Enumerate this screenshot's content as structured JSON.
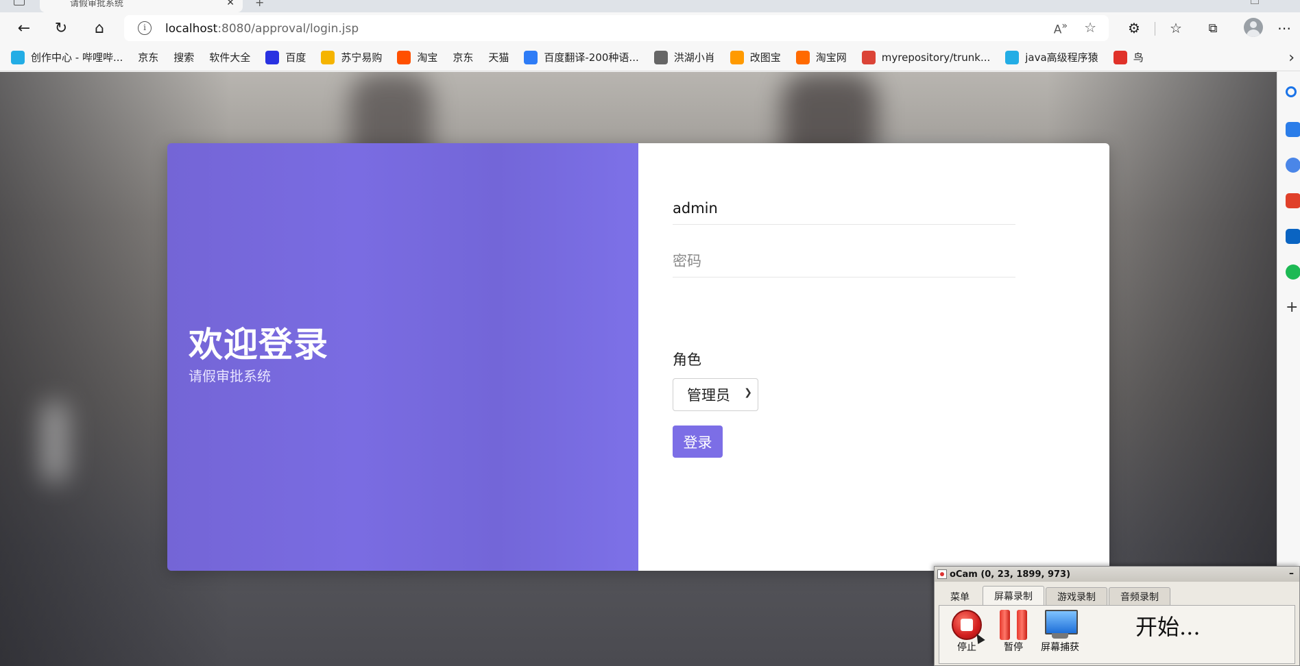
{
  "browser": {
    "tab_title": "请假审批系统",
    "url_host": "localhost",
    "url_rest": ":8080/approval/login.jsp",
    "bookmarks": [
      {
        "label": "创作中心 - 哔哩哔...",
        "icon": "bilibili-icon",
        "color": "#23ade5"
      },
      {
        "label": "京东",
        "icon": "page-icon"
      },
      {
        "label": "搜索",
        "icon": "page-icon"
      },
      {
        "label": "软件大全",
        "icon": "page-icon"
      },
      {
        "label": "百度",
        "icon": "baidu-icon",
        "color": "#2932e1"
      },
      {
        "label": "苏宁易购",
        "icon": "suning-icon",
        "color": "#f5b400"
      },
      {
        "label": "淘宝",
        "icon": "taobao-icon",
        "color": "#ff5000"
      },
      {
        "label": "京东",
        "icon": "page-icon"
      },
      {
        "label": "天猫",
        "icon": "page-icon"
      },
      {
        "label": "百度翻译-200种语...",
        "icon": "baidu-translate-icon",
        "color": "#2e7cf6"
      },
      {
        "label": "洪湖小肖",
        "icon": "bird-icon",
        "color": "#666666"
      },
      {
        "label": "改图宝",
        "icon": "gaitubao-icon",
        "color": "#ff9a00"
      },
      {
        "label": "淘宝网",
        "icon": "taobao-icon",
        "color": "#ff6a00"
      },
      {
        "label": "myrepository/trunk...",
        "icon": "chrome-icon",
        "color": "#db4437"
      },
      {
        "label": "java高级程序猿",
        "icon": "bilibili-icon",
        "color": "#23ade5"
      },
      {
        "label": "鸟",
        "icon": "bird-red-icon",
        "color": "#e0322a"
      }
    ]
  },
  "login": {
    "welcome": "欢迎登录",
    "subtitle": "请假审批系统",
    "username_value": "admin",
    "password_placeholder": "密码",
    "role_label": "角色",
    "role_selected": "管理员",
    "login_button": "登录",
    "accent_color": "#7c6ee6"
  },
  "ocam": {
    "title": "oCam (0, 23, 1899, 973)",
    "tabs": [
      "菜单",
      "屏幕录制",
      "游戏录制",
      "音频录制"
    ],
    "active_tab": "屏幕录制",
    "stop_label": "停止",
    "pause_label": "暂停",
    "capture_label": "屏幕捕获",
    "status": "开始..."
  }
}
